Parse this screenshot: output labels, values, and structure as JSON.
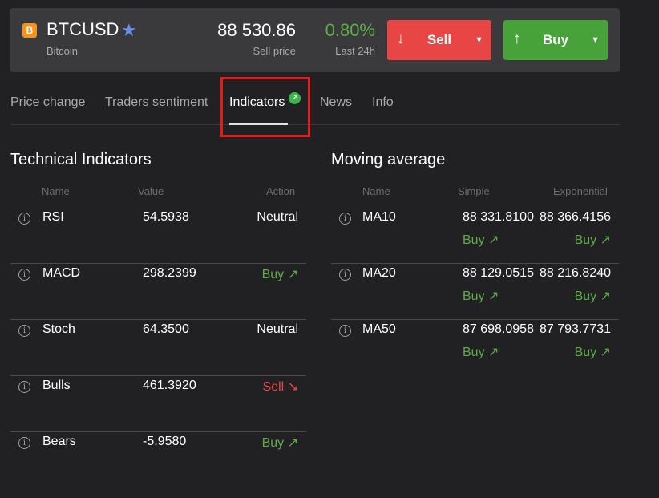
{
  "header": {
    "coin_icon": "bitcoin-icon",
    "coin_glyph": "B",
    "symbol": "BTCUSD",
    "favorite_icon": "★",
    "name": "Bitcoin",
    "price": "88 530.86",
    "price_label": "Sell price",
    "change": "0.80%",
    "change_label": "Last 24h",
    "sell_label": "Sell",
    "buy_label": "Buy",
    "sell_arrow": "↓",
    "buy_arrow": "↑",
    "caret": "▼"
  },
  "tabs": [
    {
      "label": "Price change",
      "active": false
    },
    {
      "label": "Traders sentiment",
      "active": false
    },
    {
      "label": "Indicators",
      "active": true
    },
    {
      "label": "News",
      "active": false
    },
    {
      "label": "Info",
      "active": false
    }
  ],
  "tab_badge": "↗",
  "technical": {
    "title": "Technical Indicators",
    "columns": [
      "Name",
      "Value",
      "Action"
    ],
    "rows": [
      {
        "name": "RSI",
        "value": "54.5938",
        "action": "Neutral"
      },
      {
        "name": "MACD",
        "value": "298.2399",
        "action": "Buy ↗"
      },
      {
        "name": "Stoch",
        "value": "64.3500",
        "action": "Neutral"
      },
      {
        "name": "Bulls",
        "value": "461.3920",
        "action": "Sell ↘"
      },
      {
        "name": "Bears",
        "value": "-5.9580",
        "action": "Buy ↗"
      }
    ]
  },
  "moving": {
    "title": "Moving average",
    "columns": [
      "Name",
      "Simple",
      "Exponential"
    ],
    "rows": [
      {
        "name": "MA10",
        "simple": "88 331.8100",
        "simple_action": "Buy ↗",
        "exponential": "88 366.4156",
        "exponential_action": "Buy ↗"
      },
      {
        "name": "MA20",
        "simple": "88 129.0515",
        "simple_action": "Buy ↗",
        "exponential": "88 216.8240",
        "exponential_action": "Buy ↗"
      },
      {
        "name": "MA50",
        "simple": "87 698.0958",
        "simple_action": "Buy ↗",
        "exponential": "87 793.7731",
        "exponential_action": "Buy ↗"
      }
    ]
  },
  "colors": {
    "buy": "#47a23a",
    "sell": "#e84545",
    "positive_text": "#5cac46",
    "highlight": "#e31b1b"
  }
}
